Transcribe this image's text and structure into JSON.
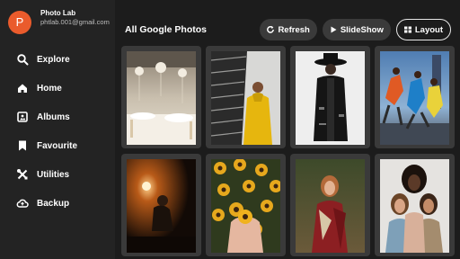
{
  "sidebar": {
    "avatar_letter": "P",
    "account_name": "Photo Lab",
    "account_email": "phtlab.001@gmail.com",
    "items": [
      {
        "label": "Explore",
        "icon": "search-icon"
      },
      {
        "label": "Home",
        "icon": "home-icon"
      },
      {
        "label": "Albums",
        "icon": "album-icon"
      },
      {
        "label": "Favourite",
        "icon": "bookmark-icon"
      },
      {
        "label": "Utilities",
        "icon": "tools-icon"
      },
      {
        "label": "Backup",
        "icon": "cloud-icon"
      }
    ]
  },
  "main": {
    "title": "All Google Photos",
    "toolbar": {
      "refresh_label": "Refresh",
      "slideshow_label": "SlideShow",
      "layout_label": "Layout"
    },
    "photos": [
      {
        "name": "photo-banquet-hall",
        "subject": "decorated banquet hall with chandeliers"
      },
      {
        "name": "photo-yellow-hoodie",
        "subject": "man in yellow hoodie by building"
      },
      {
        "name": "photo-black-outfit",
        "subject": "person in black hat and coat"
      },
      {
        "name": "photo-dancers",
        "subject": "dancers in colorful outfits"
      },
      {
        "name": "photo-candle-light",
        "subject": "person with warm light in dark"
      },
      {
        "name": "photo-sunflowers",
        "subject": "hands holding yellow flowers"
      },
      {
        "name": "photo-woman-forest",
        "subject": "woman with red scarf in forest"
      },
      {
        "name": "photo-three-women",
        "subject": "three women portrait"
      }
    ]
  },
  "colors": {
    "background": "#1c1c1c",
    "sidebar": "#232323",
    "avatar": "#ea5b2c",
    "button": "#3a3a3a",
    "tile": "#3a3a3a"
  }
}
